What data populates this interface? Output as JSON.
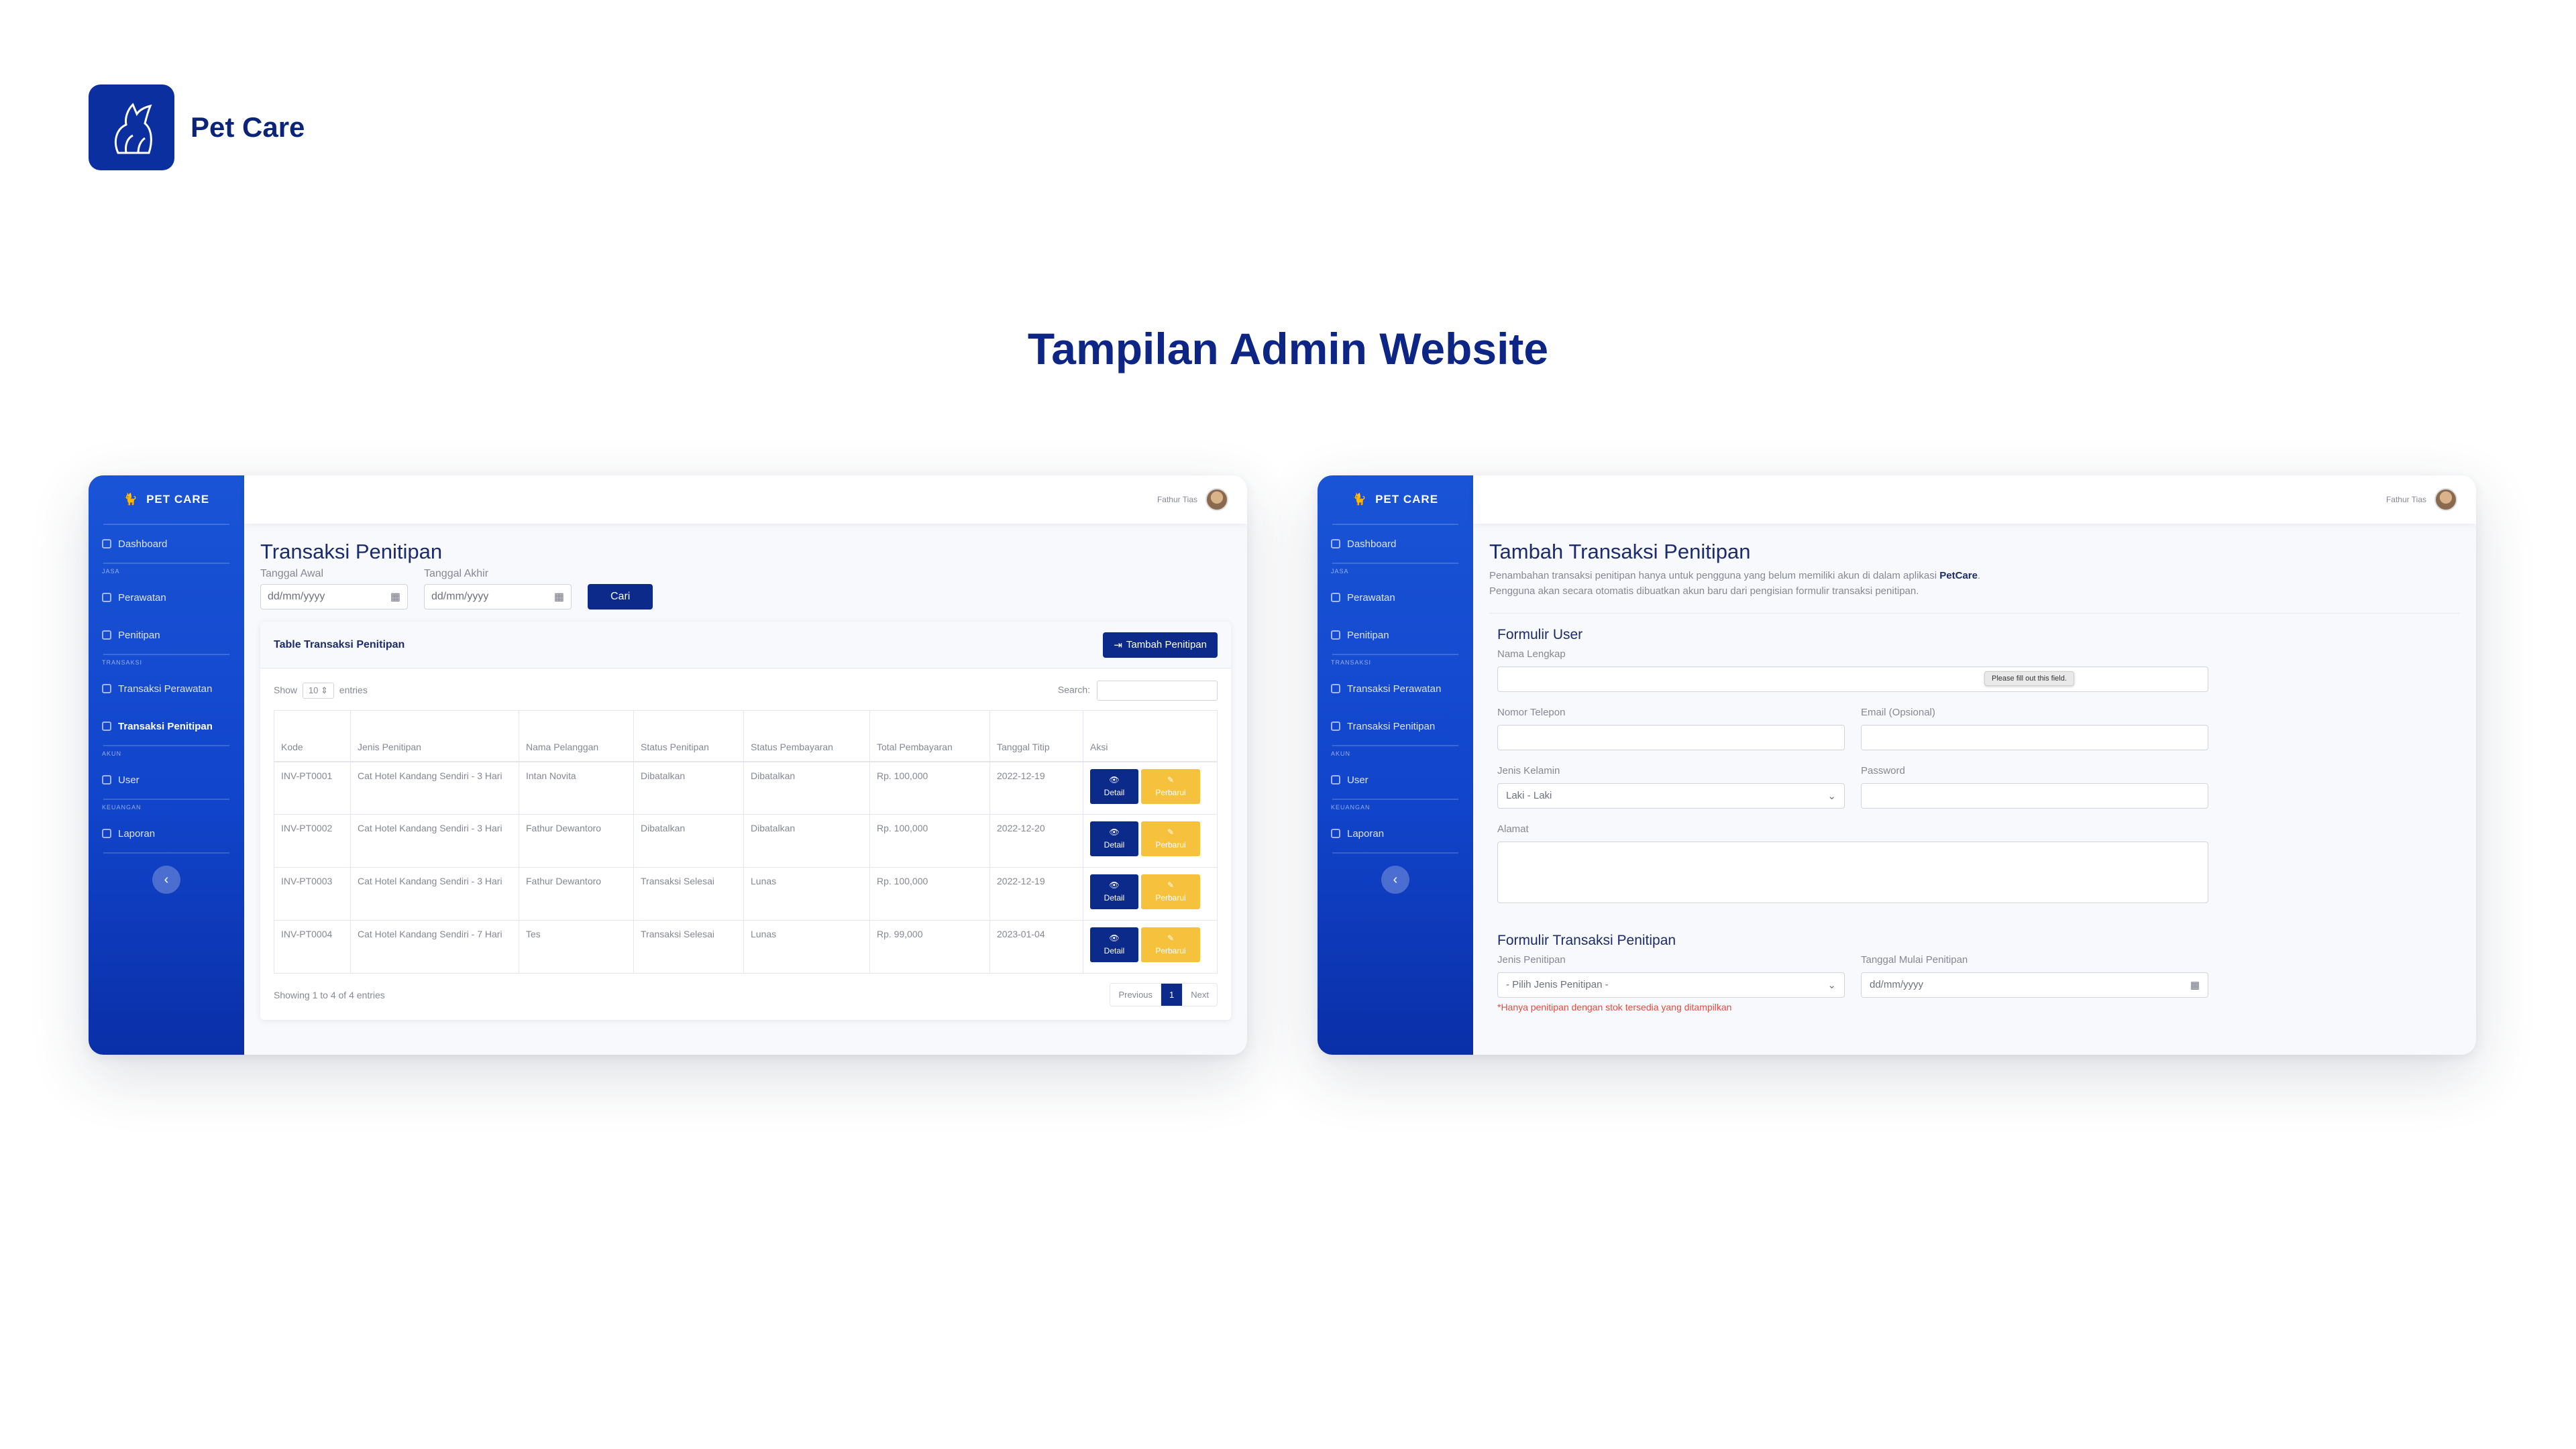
{
  "brand": {
    "name": "Pet Care"
  },
  "headline": "Tampilan Admin Website",
  "admin": {
    "brand": "PET CARE",
    "user_name": "Fathur Tias",
    "nav": {
      "dashboard": "Dashboard",
      "head_jasa": "JASA",
      "perawatan": "Perawatan",
      "penitipan": "Penitipan",
      "head_transaksi": "TRANSAKSI",
      "transaksi_perawatan": "Transaksi Perawatan",
      "transaksi_penitipan": "Transaksi Penitipan",
      "head_akun": "AKUN",
      "user": "User",
      "head_keuangan": "KEUANGAN",
      "laporan": "Laporan"
    }
  },
  "left": {
    "title": "Transaksi Penitipan",
    "label_start": "Tanggal Awal",
    "label_end": "Tanggal Akhir",
    "date_placeholder": "dd/mm/yyyy",
    "search_button": "Cari",
    "card_title": "Table Transaksi Penitipan",
    "add_button": "Tambah Penitipan",
    "show": "Show",
    "entries_value": "10",
    "entries": "entries",
    "search_label": "Search:",
    "columns": [
      "Kode",
      "Jenis Penitipan",
      "Nama Pelanggan",
      "Status Penitipan",
      "Status Pembayaran",
      "Total Pembayaran",
      "Tanggal Titip",
      "Aksi"
    ],
    "rows": [
      {
        "kode": "INV-PT0001",
        "jenis": "Cat Hotel Kandang Sendiri - 3 Hari",
        "nama": "Intan Novita",
        "status": "Dibatalkan",
        "bayar": "Dibatalkan",
        "total": "Rp. 100,000",
        "tanggal": "2022-12-19"
      },
      {
        "kode": "INV-PT0002",
        "jenis": "Cat Hotel Kandang Sendiri - 3 Hari",
        "nama": "Fathur Dewantoro",
        "status": "Dibatalkan",
        "bayar": "Dibatalkan",
        "total": "Rp. 100,000",
        "tanggal": "2022-12-20"
      },
      {
        "kode": "INV-PT0003",
        "jenis": "Cat Hotel Kandang Sendiri - 3 Hari",
        "nama": "Fathur Dewantoro",
        "status": "Transaksi Selesai",
        "bayar": "Lunas",
        "total": "Rp. 100,000",
        "tanggal": "2022-12-19"
      },
      {
        "kode": "INV-PT0004",
        "jenis": "Cat Hotel Kandang Sendiri - 7 Hari",
        "nama": "Tes",
        "status": "Transaksi Selesai",
        "bayar": "Lunas",
        "total": "Rp. 99,000",
        "tanggal": "2023-01-04"
      }
    ],
    "detail_label": "Detail",
    "edit_label": "Perbarui",
    "info": "Showing 1 to 4 of 4 entries",
    "prev": "Previous",
    "page": "1",
    "next": "Next"
  },
  "right": {
    "title": "Tambah Transaksi Penitipan",
    "desc_1": "Penambahan transaksi penitipan hanya untuk pengguna yang belum memiliki akun di dalam aplikasi ",
    "desc_brand": "PetCare",
    "desc_2": ". Pengguna akan secara otomatis dibuatkan akun baru dari pengisian formulir transaksi penitipan.",
    "section_user": "Formulir User",
    "nama": "Nama Lengkap",
    "telepon": "Nomor Telepon",
    "email": "Email (Opsional)",
    "tooltip": "Please fill out this field.",
    "kelamin": "Jenis Kelamin",
    "kelamin_value": "Laki - Laki",
    "password": "Password",
    "alamat": "Alamat",
    "section_trx": "Formulir Transaksi Penitipan",
    "jenis": "Jenis Penitipan",
    "jenis_value": "- Pilih Jenis Penitipan -",
    "tanggal_mulai": "Tanggal Mulai Penitipan",
    "date_placeholder": "dd/mm/yyyy",
    "warning": "*Hanya penitipan dengan stok tersedia yang ditampilkan"
  },
  "colors": {
    "primary": "#0c2a8a",
    "sidebar": "#1a54d6",
    "warning": "#f6c23e",
    "heading": "#0d2685"
  }
}
